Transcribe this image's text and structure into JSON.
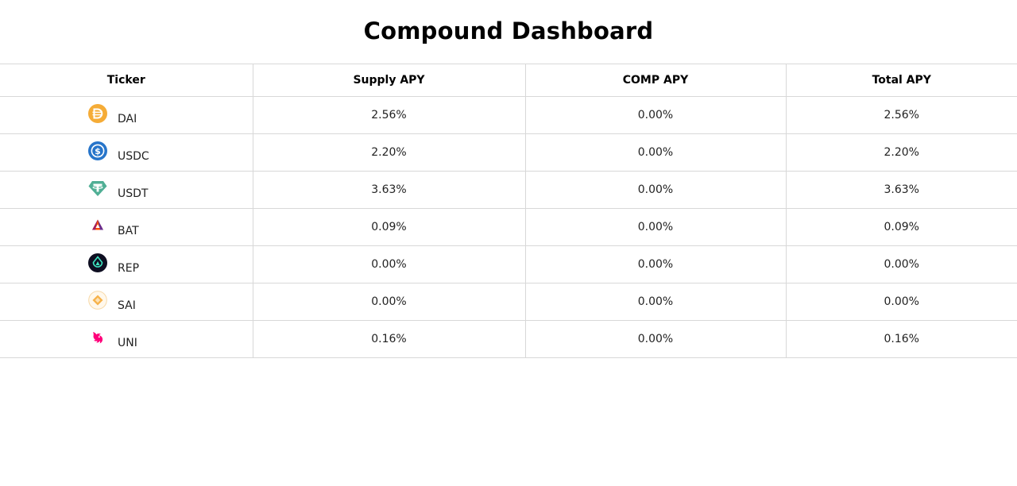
{
  "header": {
    "title": "Compound Dashboard"
  },
  "table": {
    "columns": [
      "Ticker",
      "Supply APY",
      "COMP APY",
      "Total APY"
    ],
    "rows": [
      {
        "ticker": "DAI",
        "icon": "dai-icon",
        "supply_apy": "2.56%",
        "comp_apy": "0.00%",
        "total_apy": "2.56%"
      },
      {
        "ticker": "USDC",
        "icon": "usdc-icon",
        "supply_apy": "2.20%",
        "comp_apy": "0.00%",
        "total_apy": "2.20%"
      },
      {
        "ticker": "USDT",
        "icon": "usdt-icon",
        "supply_apy": "3.63%",
        "comp_apy": "0.00%",
        "total_apy": "3.63%"
      },
      {
        "ticker": "BAT",
        "icon": "bat-icon",
        "supply_apy": "0.09%",
        "comp_apy": "0.00%",
        "total_apy": "0.09%"
      },
      {
        "ticker": "REP",
        "icon": "rep-icon",
        "supply_apy": "0.00%",
        "comp_apy": "0.00%",
        "total_apy": "0.00%"
      },
      {
        "ticker": "SAI",
        "icon": "sai-icon",
        "supply_apy": "0.00%",
        "comp_apy": "0.00%",
        "total_apy": "0.00%"
      },
      {
        "ticker": "UNI",
        "icon": "uni-icon",
        "supply_apy": "0.16%",
        "comp_apy": "0.00%",
        "total_apy": "0.16%"
      }
    ]
  },
  "colors": {
    "dai": "#f5ac37",
    "usdc": "#2775ca",
    "usdt": "#50af95",
    "bat": "#ff5000",
    "rep": "#0e0e21",
    "sai": "#f7b24a",
    "uni": "#ff007a",
    "border": "#d8d8d8"
  }
}
